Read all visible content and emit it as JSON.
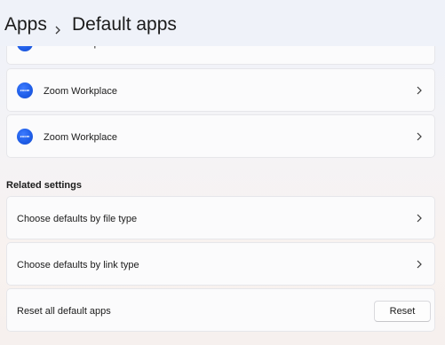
{
  "breadcrumb": {
    "parent": "Apps",
    "current": "Default apps"
  },
  "apps": [
    {
      "name": "Zoom Workplace",
      "icon": "zoom-icon",
      "icon_text": "zoom"
    },
    {
      "name": "Zoom Workplace",
      "icon": "zoom-icon",
      "icon_text": "zoom"
    },
    {
      "name": "Zoom Workplace",
      "icon": "zoom-icon",
      "icon_text": "zoom"
    }
  ],
  "related": {
    "title": "Related settings",
    "items": [
      {
        "label": "Choose defaults by file type"
      },
      {
        "label": "Choose defaults by link type"
      }
    ],
    "reset": {
      "label": "Reset all default apps",
      "button": "Reset"
    }
  },
  "colors": {
    "accent": "#1f5ee8",
    "card": "#fbfbfc",
    "header": "#eff2f9"
  }
}
